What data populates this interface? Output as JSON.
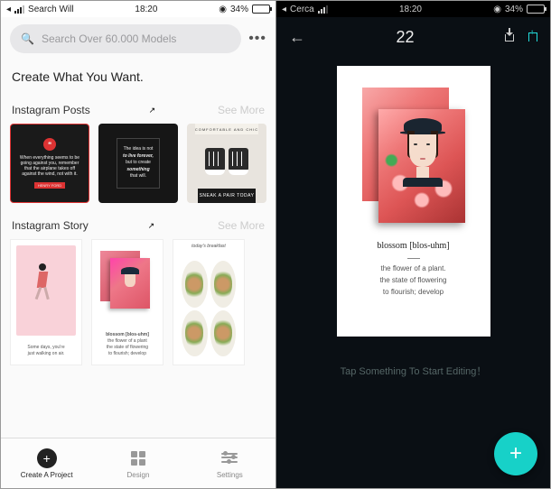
{
  "left": {
    "status": {
      "carrier": "Search Will",
      "time": "18:20",
      "battery_pct": "34%",
      "battery_fill": 34,
      "back_glyph": "◂"
    },
    "search_placeholder": "Search Over 60.000 Models",
    "more_glyph": "•••",
    "headline": "Create What You Want.",
    "sections": [
      {
        "title": "Instagram Posts",
        "more": "See More",
        "items": [
          {
            "kind": "quote_red",
            "icon": "❝",
            "text": "When everything seems to be going against you, remember that the airplane takes off against the wind, not with it.",
            "tag": "HENRY FORD"
          },
          {
            "kind": "quote_dark",
            "text1": "The idea is not",
            "text2": "to live forever,",
            "text3": "but to create",
            "text4": "something",
            "text5": "that will."
          },
          {
            "kind": "shoes",
            "top": "COMFORTABLE AND CHIC",
            "bottom": "SNEAK A PAIR TODAY"
          }
        ]
      },
      {
        "title": "Instagram Story",
        "more": "See More",
        "items": [
          {
            "kind": "walker",
            "cap1": "Some days, you're",
            "cap2": "just walking on air."
          },
          {
            "kind": "poster",
            "cap_t": "blossom [blos-uhm]",
            "cap1": "the flower of a plant",
            "cap2": "the state of flowering",
            "cap3": "to flourish; develop"
          },
          {
            "kind": "food",
            "head": "today's breakfast"
          }
        ]
      }
    ],
    "tabs": [
      {
        "label": "Create A Project",
        "icon": "plus",
        "active": true
      },
      {
        "label": "Design",
        "icon": "grid",
        "active": false
      },
      {
        "label": "Settings",
        "icon": "sliders",
        "active": false
      }
    ]
  },
  "right": {
    "status": {
      "carrier": "Cerca",
      "time": "18:20",
      "battery_pct": "34%",
      "battery_fill": 34,
      "back_glyph": "◂"
    },
    "back_arrow": "←",
    "page_count": "22",
    "canvas": {
      "title": "blossom [blos-uhm]",
      "line1": "the flower of a plant.",
      "line2": "the state of flowering",
      "line3": "to flourish; develop"
    },
    "hint": "Tap Something To Start Editing！",
    "fab_glyph": "+"
  }
}
